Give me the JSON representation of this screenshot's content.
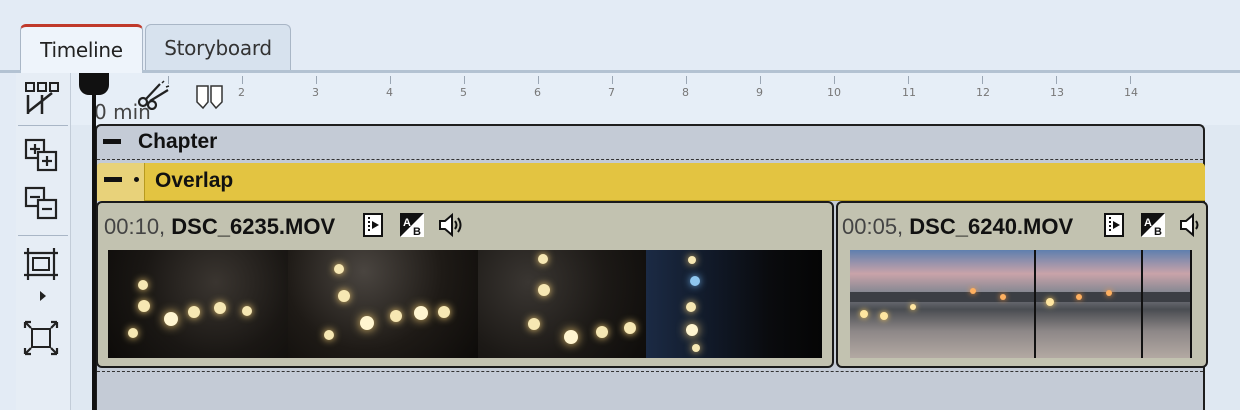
{
  "tabs": [
    {
      "label": "Timeline",
      "active": true
    },
    {
      "label": "Storyboard",
      "active": false
    }
  ],
  "ruler": {
    "zero_label": "0 min",
    "ticks": [
      "2",
      "3",
      "4",
      "5",
      "6",
      "7",
      "8",
      "9",
      "10",
      "11",
      "12",
      "13",
      "14"
    ]
  },
  "chapter": {
    "title": "Chapter"
  },
  "overlap": {
    "title": "Overlap"
  },
  "clips": [
    {
      "duration": "00:10,",
      "name": "DSC_6235.MOV"
    },
    {
      "duration": "00:05,",
      "name": "DSC_6240.MOV"
    }
  ],
  "tools": [
    "grid-tool-icon",
    "add-track-icon",
    "remove-track-icon",
    "frame-expand-icon",
    "frame-fit-icon"
  ],
  "colors": {
    "accent_tab": "#c0392b",
    "overlap": "#e3c441",
    "chapter_bg": "#c4cbd6",
    "clip_bg": "#c2c2b0"
  }
}
